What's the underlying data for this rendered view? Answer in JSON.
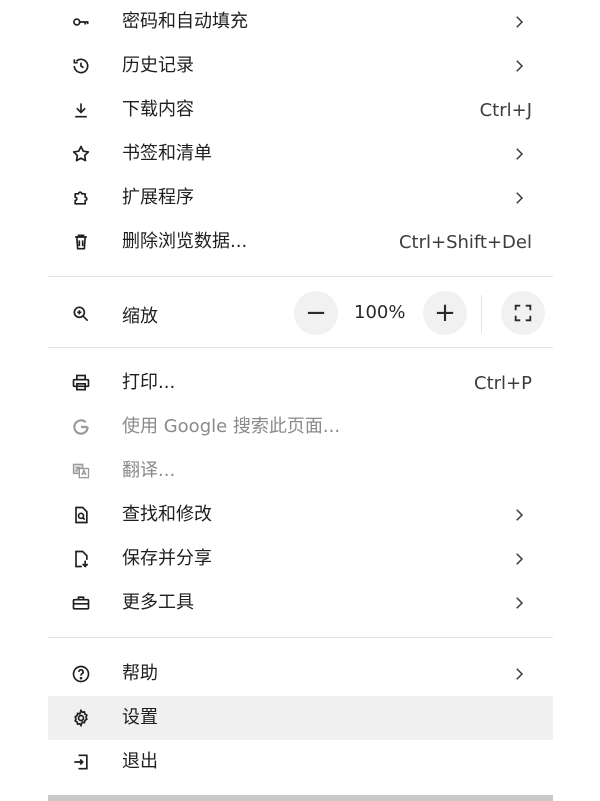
{
  "menu": {
    "items": [
      {
        "label": "密码和自动填充",
        "icon": "key-icon",
        "submenu": true
      },
      {
        "label": "历史记录",
        "icon": "history-icon",
        "submenu": true
      },
      {
        "label": "下载内容",
        "icon": "download-icon",
        "shortcut": "Ctrl+J"
      },
      {
        "label": "书签和清单",
        "icon": "star-icon",
        "submenu": true
      },
      {
        "label": "扩展程序",
        "icon": "puzzle-icon",
        "submenu": true
      },
      {
        "label": "删除浏览数据...",
        "icon": "trash-icon",
        "shortcut": "Ctrl+Shift+Del"
      }
    ],
    "zoom": {
      "label": "缩放",
      "icon": "zoom-in-icon",
      "value": "100%",
      "minus": "−",
      "plus": "+"
    },
    "items2": [
      {
        "label": "打印...",
        "icon": "printer-icon",
        "shortcut": "Ctrl+P"
      },
      {
        "label": "使用 Google 搜索此页面...",
        "icon": "google-icon",
        "disabled": true
      },
      {
        "label": "翻译...",
        "icon": "translate-icon",
        "disabled": true
      },
      {
        "label": "查找和修改",
        "icon": "find-page-icon",
        "submenu": true
      },
      {
        "label": "保存并分享",
        "icon": "save-share-icon",
        "submenu": true
      },
      {
        "label": "更多工具",
        "icon": "toolbox-icon",
        "submenu": true
      }
    ],
    "items3": [
      {
        "label": "帮助",
        "icon": "help-icon",
        "submenu": true
      },
      {
        "label": "设置",
        "icon": "settings-icon",
        "selected": true
      },
      {
        "label": "退出",
        "icon": "exit-icon"
      }
    ]
  },
  "colors": {
    "text": "#1f1f1f",
    "disabled": "#8a8a8a",
    "hover": "#f0f0f0",
    "divider": "#e3e3e3"
  }
}
